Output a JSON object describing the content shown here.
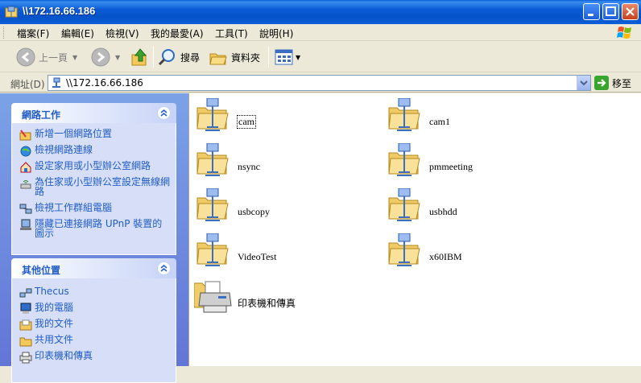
{
  "window": {
    "title": "\\\\172.16.66.186"
  },
  "menu": [
    {
      "label": "檔案(F)"
    },
    {
      "label": "編輯(E)"
    },
    {
      "label": "檢視(V)"
    },
    {
      "label": "我的最愛(A)"
    },
    {
      "label": "工具(T)"
    },
    {
      "label": "說明(H)"
    }
  ],
  "toolbar": {
    "back_label": "上一頁",
    "search_label": "搜尋",
    "folders_label": "資料夾"
  },
  "address": {
    "label": "網址(D)",
    "value": "\\\\172.16.66.186",
    "go_label": "移至"
  },
  "network_tasks": {
    "title": "網路工作",
    "items": [
      {
        "label": "新增一個網路位置",
        "icon": "add-network-place-icon"
      },
      {
        "label": "檢視網路連線",
        "icon": "network-connections-icon"
      },
      {
        "label": "設定家用或小型辦公室網路",
        "icon": "home-network-icon"
      },
      {
        "label": "為住家或小型辦公室設定無線網路",
        "icon": "wireless-network-icon"
      },
      {
        "label": "檢視工作群組電腦",
        "icon": "workgroup-icon"
      },
      {
        "label": "隱藏已連接網路 UPnP 裝置的圖示",
        "icon": "upnp-icon"
      }
    ]
  },
  "other_places": {
    "title": "其他位置",
    "items": [
      {
        "label": "Thecus",
        "icon": "network-icon"
      },
      {
        "label": "我的電腦",
        "icon": "my-computer-icon"
      },
      {
        "label": "我的文件",
        "icon": "my-documents-icon"
      },
      {
        "label": "共用文件",
        "icon": "shared-documents-icon"
      },
      {
        "label": "印表機和傳真",
        "icon": "printer-icon"
      }
    ]
  },
  "shares": [
    {
      "label": "cam",
      "selected": true
    },
    {
      "label": "cam1"
    },
    {
      "label": "nsync"
    },
    {
      "label": "pmmeeting"
    },
    {
      "label": "usbcopy"
    },
    {
      "label": "usbhdd"
    },
    {
      "label": "VideoTest"
    },
    {
      "label": "x60IBM"
    },
    {
      "label": "印表機和傳真",
      "type": "printers"
    }
  ],
  "colors": {
    "title_bar": "#0a5fd8",
    "task_link": "#215dc6",
    "left_pane": "#7ba2e7"
  }
}
